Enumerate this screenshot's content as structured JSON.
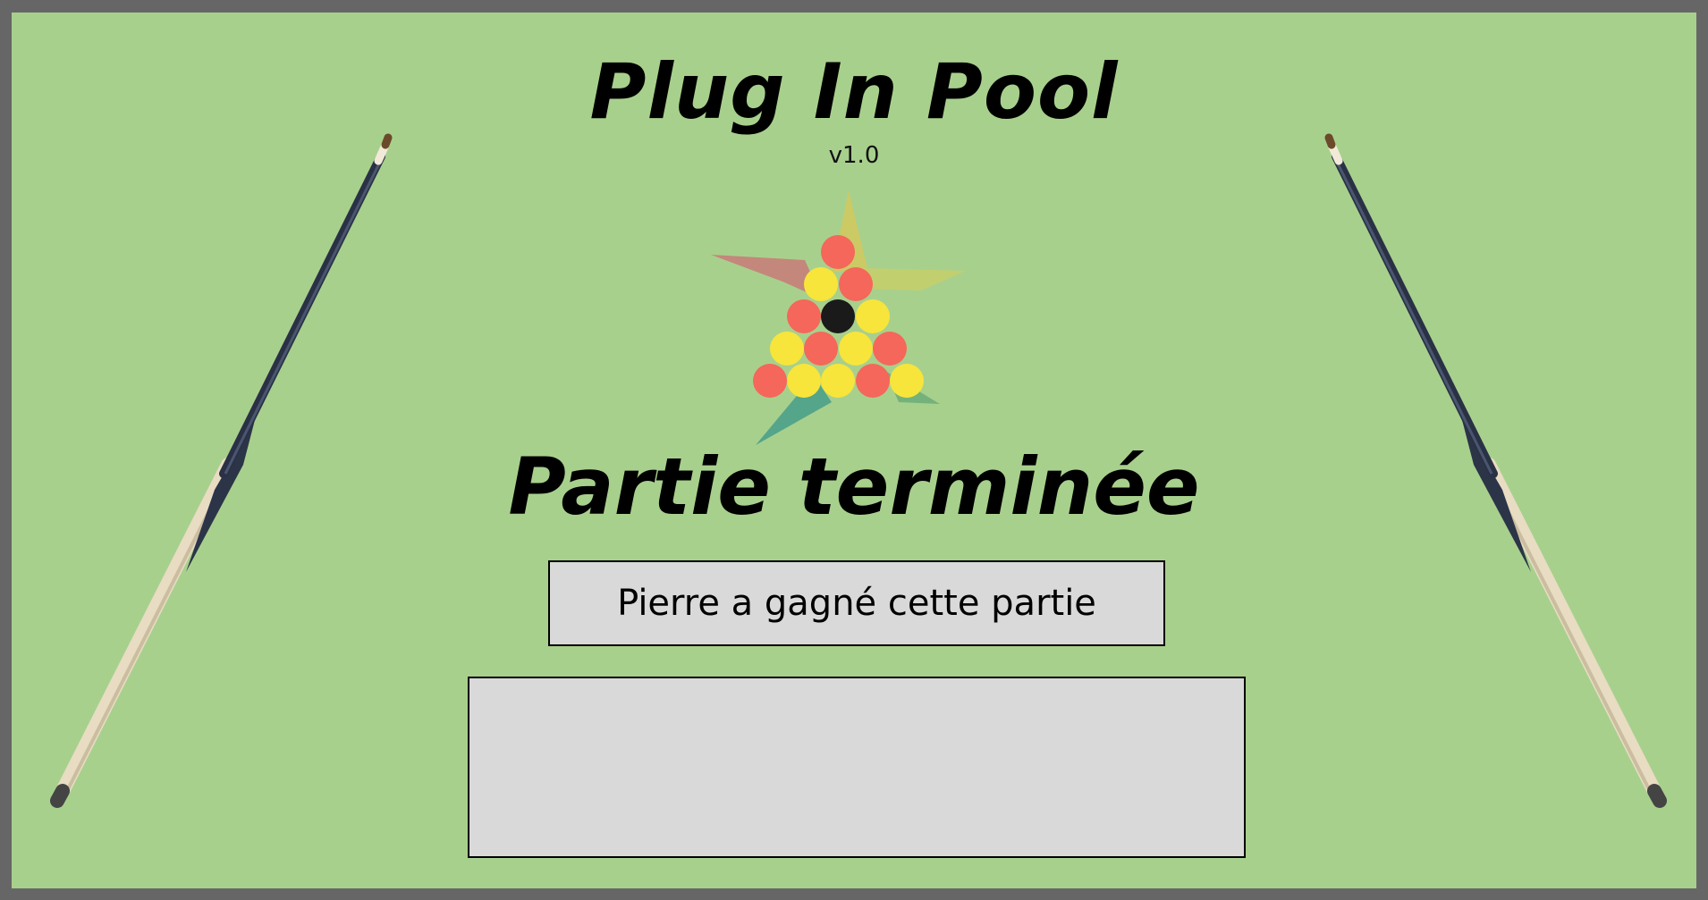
{
  "title": "Plug In Pool",
  "version": "v1.0",
  "status_title": "Partie terminée",
  "winner_message": "Pierre a gagné cette partie",
  "colors": {
    "frame": "#666666",
    "felt": "#a8d08d",
    "panel": "#d9d9d9",
    "ball_red": "#f4675a",
    "ball_yellow": "#f7e53b",
    "ball_black": "#1a1a1a"
  },
  "icons": {
    "logo": "pool-rack-star-logo",
    "left_cue": "pool-cue-icon",
    "right_cue": "pool-cue-icon"
  }
}
